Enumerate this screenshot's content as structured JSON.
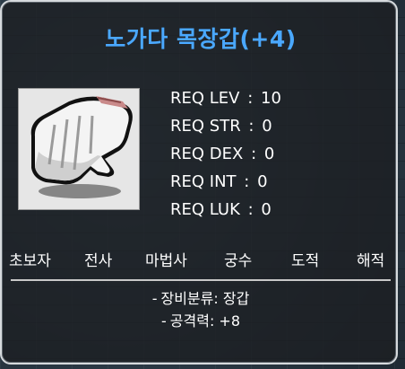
{
  "item": {
    "name": "노가다 목장갑(+4)",
    "icon": "white-work-glove-icon"
  },
  "requirements": [
    {
      "label": "REQ LEV",
      "value": "10"
    },
    {
      "label": "REQ STR",
      "value": "0"
    },
    {
      "label": "REQ DEX",
      "value": "0"
    },
    {
      "label": "REQ INT",
      "value": "0"
    },
    {
      "label": "REQ LUK",
      "value": "0"
    }
  ],
  "jobs": [
    "초보자",
    "전사",
    "마법사",
    "궁수",
    "도적",
    "해적"
  ],
  "stats": [
    {
      "prefix": "-",
      "label": "장비분류",
      "value": "장갑"
    },
    {
      "prefix": "-",
      "label": "공격력",
      "value": "+8"
    }
  ],
  "colors": {
    "title": "#4aa8ff",
    "text": "#ffffff",
    "panel_border": "#d6dadd"
  }
}
